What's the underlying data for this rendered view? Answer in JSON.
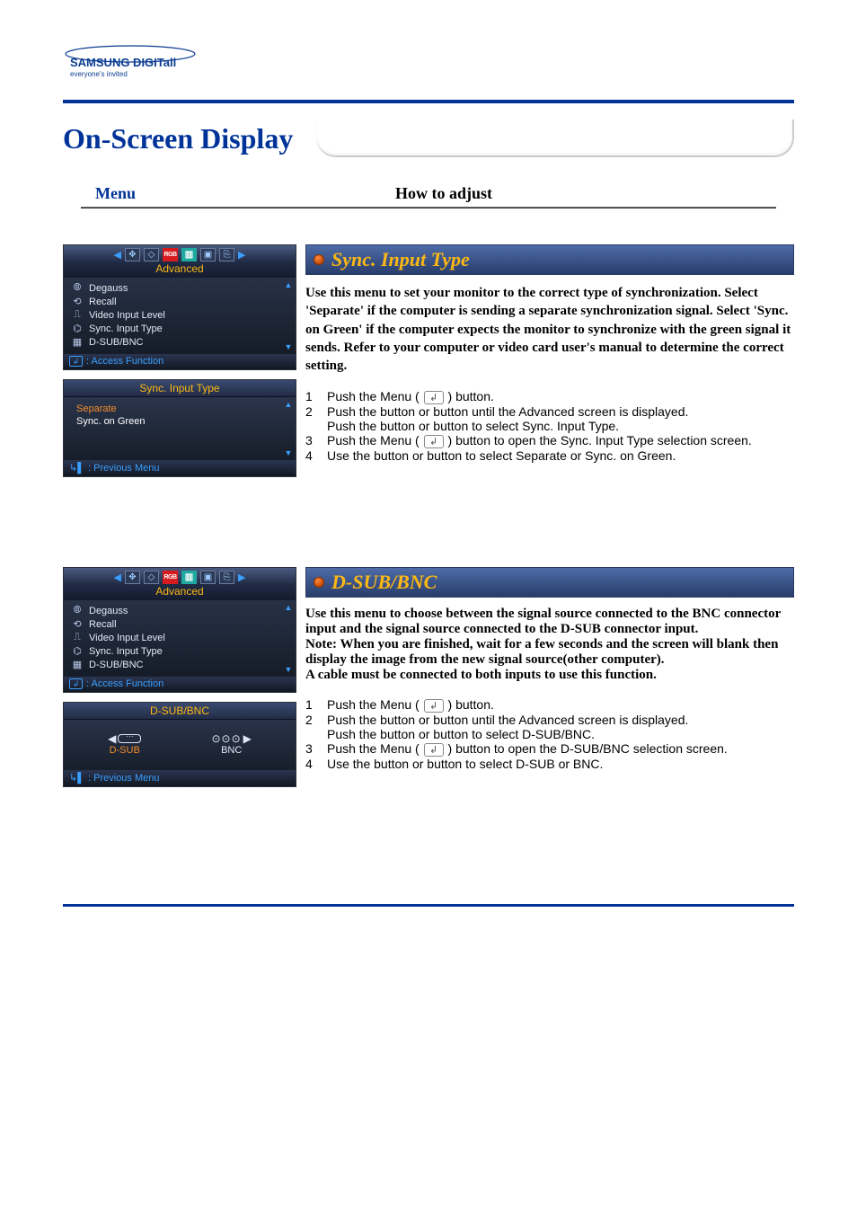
{
  "brand": {
    "name": "SAMSUNG DIGITall",
    "tagline": "everyone's invited"
  },
  "title": "On-Screen Display",
  "headers": {
    "menu": "Menu",
    "how_to_adjust": "How to adjust"
  },
  "osd_common": {
    "topbar_label": "Advanced",
    "topbar_rgb": "RGB",
    "access_function": ": Access Function",
    "previous_menu": ": Previous Menu",
    "items": {
      "degauss": "Degauss",
      "recall": "Recall",
      "video_input_level": "Video Input Level",
      "sync_input_type": "Sync. Input Type",
      "dsub_bnc": "D-SUB/BNC"
    }
  },
  "sync": {
    "osd_subhead": "Sync. Input Type",
    "options": {
      "separate": "Separate",
      "sync_on_green": "Sync. on Green"
    },
    "title": "Sync. Input Type",
    "desc": "Use this menu to set your monitor to the correct type of synchronization. Select 'Separate' if the computer is sending a separate synchronization signal. Select 'Sync. on Green' if the computer expects the monitor to synchronize with the green signal it sends. Refer to your computer or video card user's manual to determine the correct setting.",
    "steps": {
      "s1a": "Push the Menu ( ",
      "s1b": " ) button.",
      "s2a": "Push the     button or      button until the Advanced screen is displayed.",
      "s2b": "Push the     button or      button to select Sync. Input Type.",
      "s3a": "Push the Menu ( ",
      "s3b": " ) button to open the Sync. Input Type selection screen.",
      "s4": "Use the     button or      button to select Separate or Sync. on Green."
    }
  },
  "dsub": {
    "osd_subhead": "D-SUB/BNC",
    "options": {
      "dsub": "D-SUB",
      "bnc": "BNC"
    },
    "title": "D-SUB/BNC",
    "desc": "Use this menu to choose between the signal source connected to the BNC connector input and the signal source connected to the D-SUB connector input.",
    "note": "Note: When you are finished, wait for a few seconds and the screen will blank then display the image from the new signal source(other computer).",
    "note2": "A cable must be connected to both inputs to use this function.",
    "steps": {
      "s1a": "Push the Menu ( ",
      "s1b": " ) button.",
      "s2a": "Push the     button or      button until the Advanced screen is displayed.",
      "s2b": "Push the     button or      button to select D-SUB/BNC.",
      "s3a": "Push the Menu ( ",
      "s3b": " ) button to open the D-SUB/BNC selection screen.",
      "s4": "Use the     button or      button to select D-SUB or BNC."
    }
  }
}
